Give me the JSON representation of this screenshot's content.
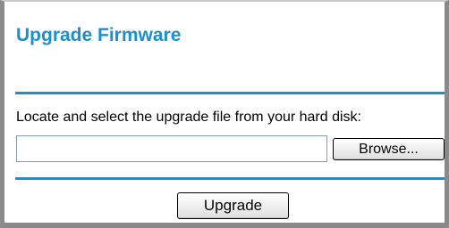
{
  "panel": {
    "title": "Upgrade Firmware",
    "instructions": "Locate and select the upgrade file from your hard disk:",
    "file_input": {
      "value": "",
      "placeholder": ""
    },
    "browse_label": "Browse...",
    "upgrade_label": "Upgrade"
  },
  "colors": {
    "accent": "#1b8fd0",
    "frame": "#8a8a8a"
  }
}
